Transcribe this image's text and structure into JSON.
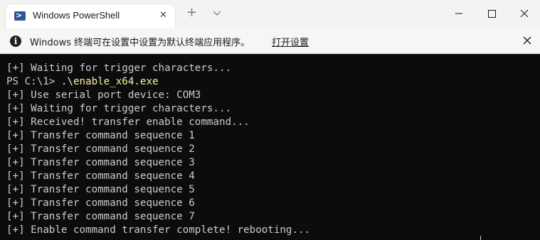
{
  "window": {
    "tab_title": "Windows PowerShell",
    "tab_icon": "powershell-icon",
    "tab_close_label": "✕",
    "new_tab_label": "+"
  },
  "infobar": {
    "message": "Windows 终端可在设置中设置为默认终端应用程序。",
    "link_label": "打开设置"
  },
  "terminal": {
    "lines": [
      "[+] Waiting for trigger characters...",
      "PS C:\\1> ",
      "[+] Use serial port device: COM3",
      "[+] Waiting for trigger characters...",
      "[+] Received! transfer enable command...",
      "[+] Transfer command sequence 1",
      "[+] Transfer command sequence 2",
      "[+] Transfer command sequence 3",
      "[+] Transfer command sequence 4",
      "[+] Transfer command sequence 5",
      "[+] Transfer command sequence 6",
      "[+] Transfer command sequence 7",
      "[+] Enable command transfer complete! rebooting..."
    ],
    "prompt_command": ".\\enable_x64.exe"
  },
  "colors": {
    "terminal_bg": "#0c0c0c",
    "terminal_fg": "#cccccc",
    "command_fg": "#f9f1a5",
    "titlebar_bg": "#f3f3f3"
  }
}
